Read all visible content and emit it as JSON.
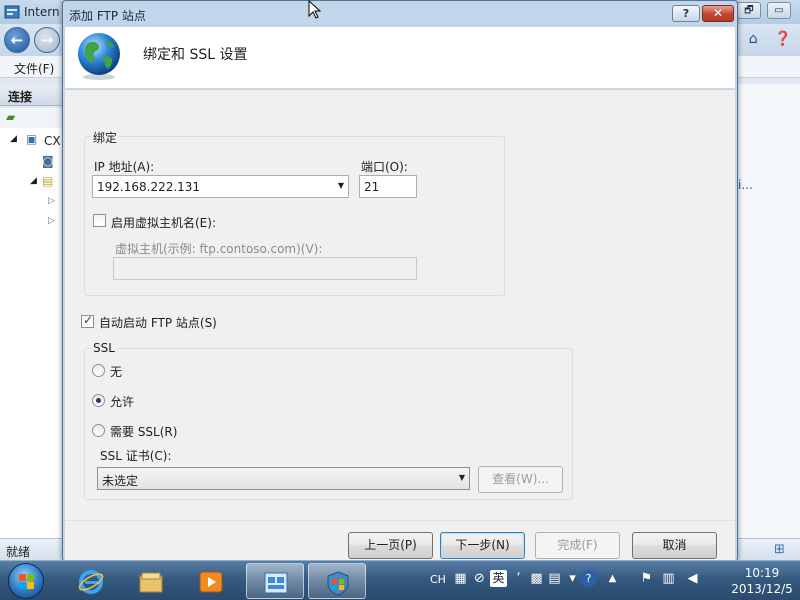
{
  "background_window": {
    "title": "Intern",
    "menu_file": "文件(F)",
    "connections_header": "连接",
    "tree_root_label": "CX",
    "status_text": "就绪",
    "right_link": "i...",
    "controls": {
      "restore": "🗗",
      "minimize": "▭",
      "close": "✕"
    }
  },
  "dialog": {
    "title": "添加 FTP 站点",
    "help_label": "?",
    "close_label": "✕",
    "heading": "绑定和 SSL 设置",
    "binding": {
      "group_title": "绑定",
      "ip_label": "IP 地址(A):",
      "ip_value": "192.168.222.131",
      "port_label": "端口(O):",
      "port_value": "21",
      "virtual_host_checkbox_label": "启用虚拟主机名(E):",
      "virtual_host_checked": false,
      "virtual_host_field_label": "虚拟主机(示例: ftp.contoso.com)(V):",
      "virtual_host_value": ""
    },
    "auto_start": {
      "label": "自动启动 FTP 站点(S)",
      "checked": true
    },
    "ssl": {
      "group_title": "SSL",
      "options": [
        "无",
        "允许",
        "需要 SSL(R)"
      ],
      "selected_index": 1,
      "cert_label": "SSL 证书(C):",
      "cert_value": "未选定",
      "view_button": "查看(W)..."
    },
    "buttons": {
      "previous": "上一页(P)",
      "next": "下一步(N)",
      "finish": "完成(F)",
      "cancel": "取消"
    }
  },
  "taskbar": {
    "language": "CH",
    "ime": "英",
    "time": "10:19",
    "date": "2013/12/5"
  },
  "colors": {
    "dialog_frame": "#c2d6ea",
    "taskbar": "#35597f",
    "close_button": "#c2452f",
    "default_button_border": "#3c7fb1"
  },
  "icons": {
    "dialog_header": "globe-icon",
    "taskbar": [
      "ie-icon",
      "explorer-icon",
      "media-player-icon",
      "iis-manager-icon",
      "setup-icon"
    ]
  }
}
